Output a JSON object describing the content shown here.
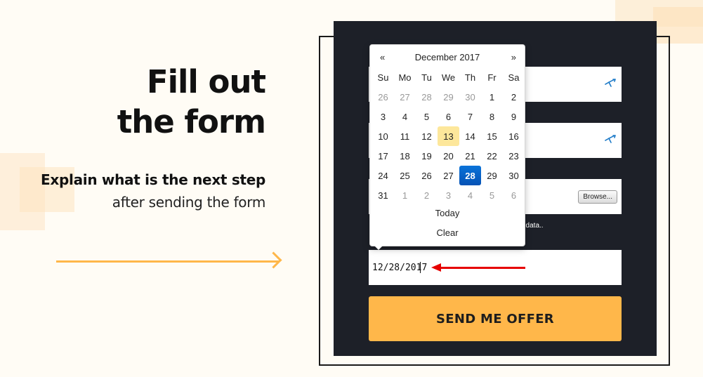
{
  "hero": {
    "title_line1": "Fill out",
    "title_line2": "the form",
    "subtitle_bold": "Explain what is the next step",
    "subtitle_light": "after sending the form"
  },
  "form": {
    "consent_text": "al data..",
    "browse_label": "Browse...",
    "date_value": "12/28/2017",
    "submit_label": "SEND ME OFFER"
  },
  "datepicker": {
    "prev": "«",
    "next": "»",
    "title": "December 2017",
    "weekdays": [
      "Su",
      "Mo",
      "Tu",
      "We",
      "Th",
      "Fr",
      "Sa"
    ],
    "weeks": [
      [
        {
          "d": "26",
          "m": true
        },
        {
          "d": "27",
          "m": true
        },
        {
          "d": "28",
          "m": true
        },
        {
          "d": "29",
          "m": true
        },
        {
          "d": "30",
          "m": true
        },
        {
          "d": "1"
        },
        {
          "d": "2"
        }
      ],
      [
        {
          "d": "3"
        },
        {
          "d": "4"
        },
        {
          "d": "5"
        },
        {
          "d": "6"
        },
        {
          "d": "7"
        },
        {
          "d": "8"
        },
        {
          "d": "9"
        }
      ],
      [
        {
          "d": "10"
        },
        {
          "d": "11"
        },
        {
          "d": "12"
        },
        {
          "d": "13",
          "today": true
        },
        {
          "d": "14"
        },
        {
          "d": "15"
        },
        {
          "d": "16"
        }
      ],
      [
        {
          "d": "17"
        },
        {
          "d": "18"
        },
        {
          "d": "19"
        },
        {
          "d": "20"
        },
        {
          "d": "21"
        },
        {
          "d": "22"
        },
        {
          "d": "23"
        }
      ],
      [
        {
          "d": "24"
        },
        {
          "d": "25"
        },
        {
          "d": "26"
        },
        {
          "d": "27"
        },
        {
          "d": "28",
          "selected": true
        },
        {
          "d": "29"
        },
        {
          "d": "30"
        }
      ],
      [
        {
          "d": "31"
        },
        {
          "d": "1",
          "m": true
        },
        {
          "d": "2",
          "m": true
        },
        {
          "d": "3",
          "m": true
        },
        {
          "d": "4",
          "m": true
        },
        {
          "d": "5",
          "m": true
        },
        {
          "d": "6",
          "m": true
        }
      ]
    ],
    "today_label": "Today",
    "clear_label": "Clear"
  },
  "colors": {
    "accent": "#ffb74a",
    "panel": "#1d2028",
    "selected_day": "#0a73d9",
    "today_day": "#fde79b",
    "annotation_arrow": "#e60000"
  },
  "icons": {
    "field_icon": "swoosh-icon"
  }
}
